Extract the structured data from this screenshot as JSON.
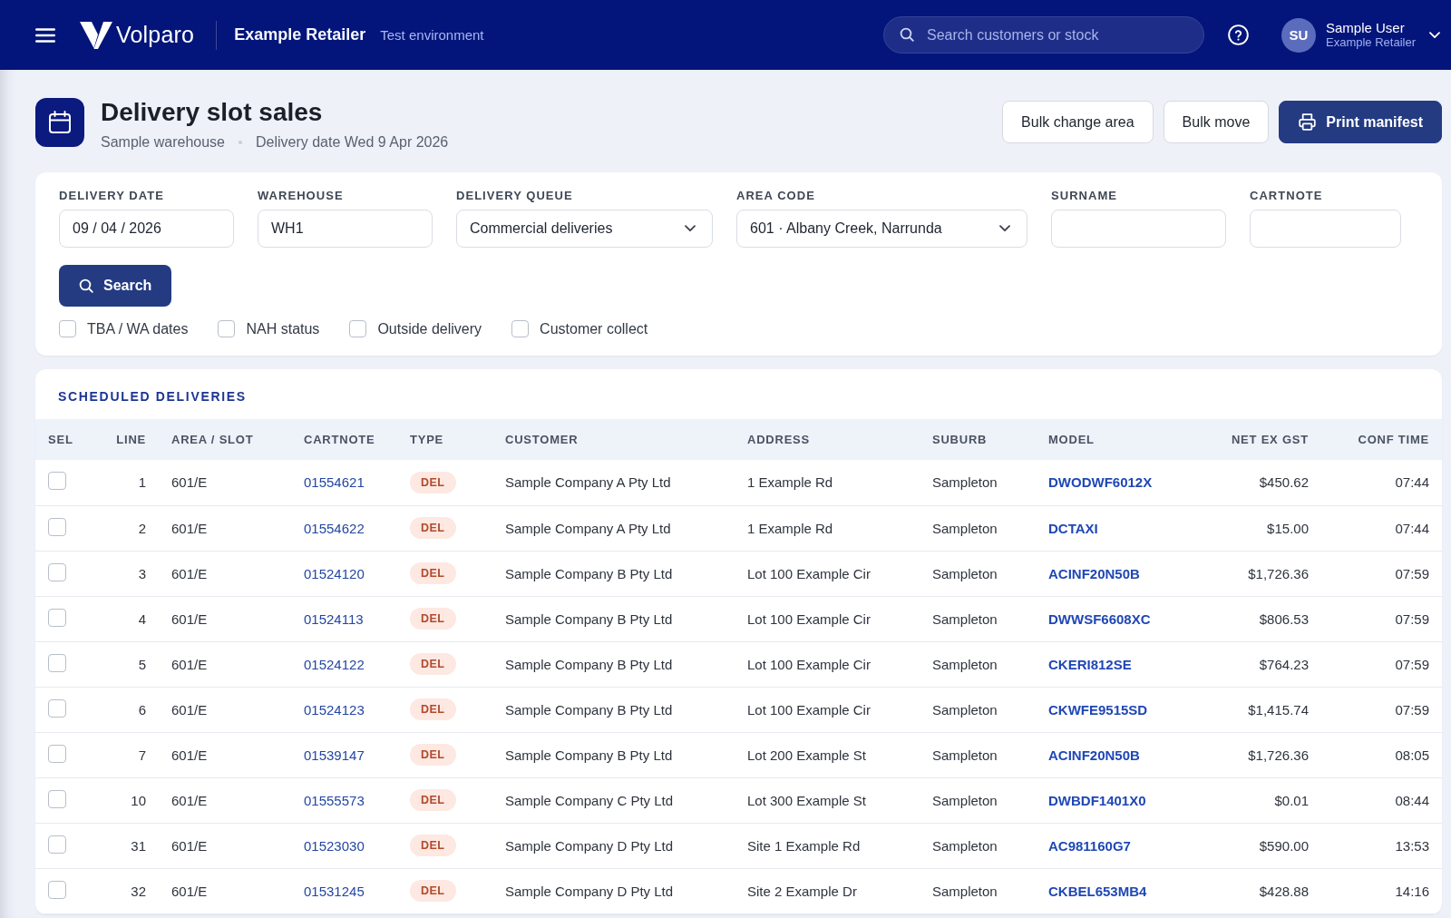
{
  "header": {
    "app_name": "Volparo",
    "company": "Example Retailer",
    "environment": "Test environment",
    "search": {
      "placeholder": "Search customers or stock"
    },
    "user": {
      "initials": "SU",
      "name": "Sample User",
      "organisation": "Example Retailer"
    }
  },
  "page": {
    "title": "Delivery slot sales",
    "warehouse": "Sample warehouse",
    "delivery_date": "Delivery date Wed 9 Apr 2026",
    "actions": [
      {
        "label": "Bulk change area",
        "kind": "secondary"
      },
      {
        "label": "Bulk move",
        "kind": "secondary"
      },
      {
        "label": "Print manifest",
        "kind": "primary"
      }
    ]
  },
  "filters": {
    "fields": [
      {
        "label": "DELIVERY DATE",
        "kind": "input",
        "value": "09 / 04 / 2026"
      },
      {
        "label": "WAREHOUSE",
        "kind": "input",
        "value": "WH1"
      },
      {
        "label": "DELIVERY QUEUE",
        "kind": "select",
        "value": "Commercial deliveries"
      },
      {
        "label": "AREA CODE",
        "kind": "select",
        "value": "601 · Albany Creek, Narrunda"
      },
      {
        "label": "SURNAME",
        "kind": "input"
      },
      {
        "label": "CARTNOTE",
        "kind": "input"
      }
    ],
    "search_button": "Search",
    "options": [
      {
        "label": "TBA / WA dates",
        "checked": false
      },
      {
        "label": "NAH status",
        "checked": false
      },
      {
        "label": "Outside delivery",
        "checked": false
      },
      {
        "label": "Customer collect",
        "checked": false
      }
    ]
  },
  "table": {
    "title": "SCHEDULED DELIVERIES",
    "columns": [
      "SEL",
      "LINE",
      "AREA / SLOT",
      "CARTNOTE",
      "TYPE",
      "CUSTOMER",
      "ADDRESS",
      "SUBURB",
      "MODEL",
      "NET EX GST",
      "CONF TIME"
    ],
    "rows": [
      {
        "selected": false,
        "line": "1",
        "area_slot": "601/E",
        "cartnote": "01554621",
        "type": "DEL",
        "customer": "Sample Company A Pty Ltd",
        "address": "1 Example Rd",
        "suburb": "Sampleton",
        "model": "DWODWF6012X",
        "net_ex_gst": "$450.62",
        "conf_time": "07:44"
      },
      {
        "selected": false,
        "line": "2",
        "area_slot": "601/E",
        "cartnote": "01554622",
        "type": "DEL",
        "customer": "Sample Company A Pty Ltd",
        "address": "1 Example Rd",
        "suburb": "Sampleton",
        "model": "DCTAXI",
        "net_ex_gst": "$15.00",
        "conf_time": "07:44"
      },
      {
        "selected": false,
        "line": "3",
        "area_slot": "601/E",
        "cartnote": "01524120",
        "type": "DEL",
        "customer": "Sample Company B Pty Ltd",
        "address": "Lot 100 Example Cir",
        "suburb": "Sampleton",
        "model": "ACINF20N50B",
        "net_ex_gst": "$1,726.36",
        "conf_time": "07:59"
      },
      {
        "selected": false,
        "line": "4",
        "area_slot": "601/E",
        "cartnote": "01524113",
        "type": "DEL",
        "customer": "Sample Company B Pty Ltd",
        "address": "Lot 100 Example Cir",
        "suburb": "Sampleton",
        "model": "DWWSF6608XC",
        "net_ex_gst": "$806.53",
        "conf_time": "07:59"
      },
      {
        "selected": false,
        "line": "5",
        "area_slot": "601/E",
        "cartnote": "01524122",
        "type": "DEL",
        "customer": "Sample Company B Pty Ltd",
        "address": "Lot 100 Example Cir",
        "suburb": "Sampleton",
        "model": "CKERI812SE",
        "net_ex_gst": "$764.23",
        "conf_time": "07:59"
      },
      {
        "selected": false,
        "line": "6",
        "area_slot": "601/E",
        "cartnote": "01524123",
        "type": "DEL",
        "customer": "Sample Company B Pty Ltd",
        "address": "Lot 100 Example Cir",
        "suburb": "Sampleton",
        "model": "CKWFE9515SD",
        "net_ex_gst": "$1,415.74",
        "conf_time": "07:59"
      },
      {
        "selected": false,
        "line": "7",
        "area_slot": "601/E",
        "cartnote": "01539147",
        "type": "DEL",
        "customer": "Sample Company B Pty Ltd",
        "address": "Lot 200 Example St",
        "suburb": "Sampleton",
        "model": "ACINF20N50B",
        "net_ex_gst": "$1,726.36",
        "conf_time": "08:05"
      },
      {
        "selected": false,
        "line": "10",
        "area_slot": "601/E",
        "cartnote": "01555573",
        "type": "DEL",
        "customer": "Sample Company C Pty Ltd",
        "address": "Lot 300 Example St",
        "suburb": "Sampleton",
        "model": "DWBDF1401X0",
        "net_ex_gst": "$0.01",
        "conf_time": "08:44"
      },
      {
        "selected": false,
        "line": "31",
        "area_slot": "601/E",
        "cartnote": "01523030",
        "type": "DEL",
        "customer": "Sample Company D Pty Ltd",
        "address": "Site 1 Example Rd",
        "suburb": "Sampleton",
        "model": "AC981160G7",
        "net_ex_gst": "$590.00",
        "conf_time": "13:53"
      },
      {
        "selected": false,
        "line": "32",
        "area_slot": "601/E",
        "cartnote": "01531245",
        "type": "DEL",
        "customer": "Sample Company D Pty Ltd",
        "address": "Site 2 Example Dr",
        "suburb": "Sampleton",
        "model": "CKBEL653MB4",
        "net_ex_gst": "$428.88",
        "conf_time": "14:16"
      }
    ]
  }
}
